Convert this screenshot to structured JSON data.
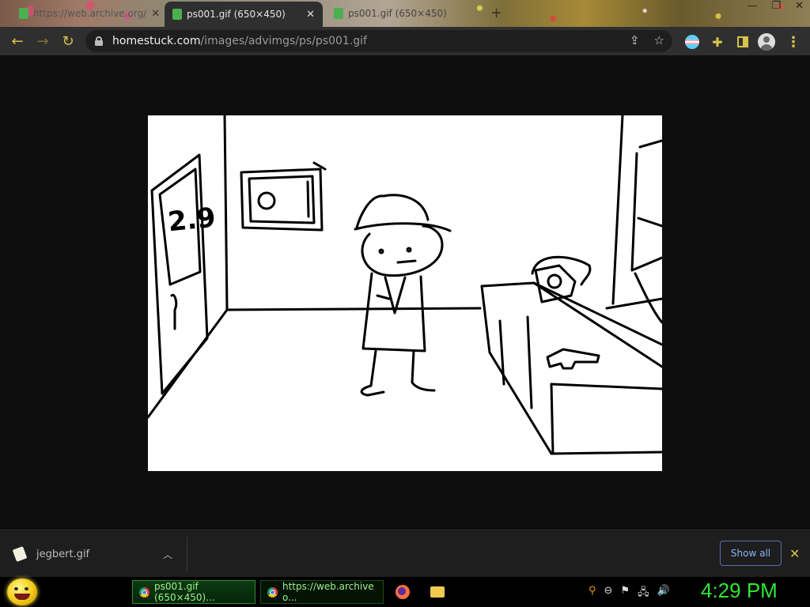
{
  "tabs": [
    {
      "title": "https://web.archive.org/",
      "active": false
    },
    {
      "title": "ps001.gif (650×450)",
      "active": true
    },
    {
      "title": "ps001.gif (650×450)",
      "active": false
    }
  ],
  "toolbar": {
    "url_host": "homestuck.com",
    "url_path": "/images/advimgs/ps/ps001.gif"
  },
  "image": {
    "door_sign": "2.9"
  },
  "downloads": {
    "file_name": "jegbert.gif",
    "show_all_label": "Show all"
  },
  "taskbar": {
    "tasks": [
      {
        "label": "ps001.gif (650×450)..."
      },
      {
        "label": "https://web.archive o..."
      }
    ],
    "clock": "4:29 PM"
  },
  "colors": {
    "accent": "#d8c34a",
    "taskbar_text": "#9cf28f",
    "clock": "#33e533",
    "link": "#8ab4f8"
  }
}
